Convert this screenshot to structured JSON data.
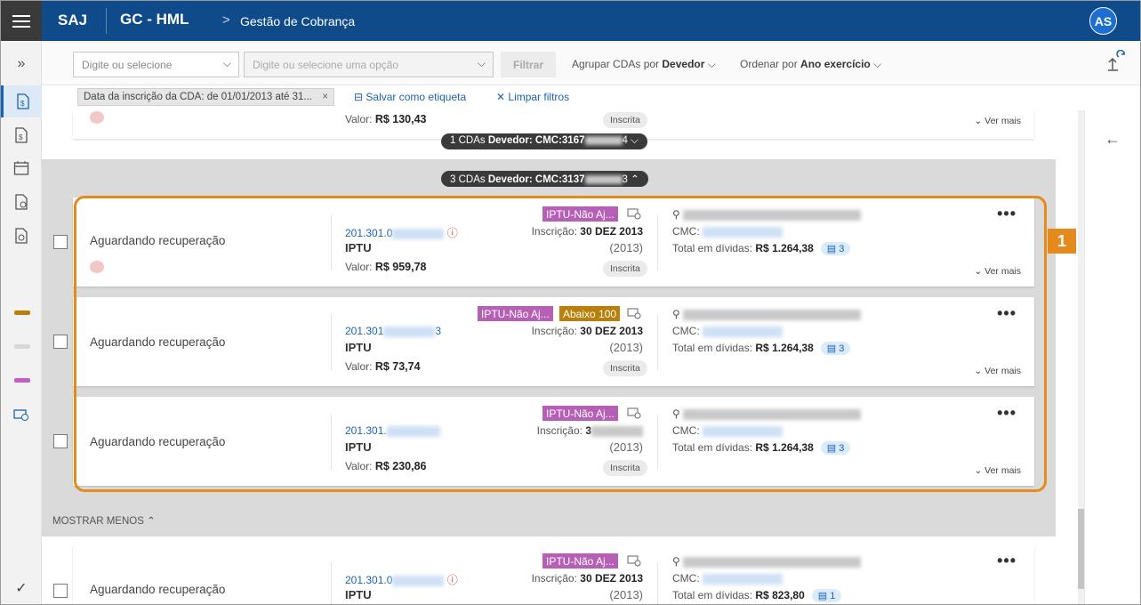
{
  "header": {
    "brand": "SAJ",
    "environment": "GC - HML",
    "breadcrumb_sep": ">",
    "breadcrumb": "Gestão de Cobrança",
    "avatar_initials": "AS"
  },
  "rail": {
    "expand_label": "»",
    "check_label": "✓",
    "bars": [
      "#b8800a",
      "#d8d8d8",
      "#c35fc3"
    ]
  },
  "toolbar": {
    "select1_placeholder": "Digite ou selecione",
    "select2_placeholder": "Digite ou selecione uma opção",
    "filter_button": "Filtrar",
    "group_prefix": "Agrupar CDAs por",
    "group_value": "Devedor",
    "order_prefix": "Ordenar por",
    "order_value": "Ano exercício"
  },
  "chips": {
    "date_chip": "Data da inscrição da CDA: de 01/01/2013 até 31...",
    "chip_close": "×",
    "save_tag": "Salvar como etiqueta",
    "clear_filters": "Limpar filtros"
  },
  "top_card": {
    "valor_label": "Valor:",
    "valor": "R$ 130,43",
    "status_pill": "Inscrita",
    "ver_mais": "Ver mais"
  },
  "groups": [
    {
      "count": "1",
      "label": "CDAs",
      "debtor": "Devedor: CMC:3167",
      "suffix": "4",
      "chevron": "down"
    },
    {
      "count": "3",
      "label": "CDAs",
      "debtor": "Devedor: CMC:3137",
      "suffix": "3",
      "chevron": "up"
    }
  ],
  "cards": [
    {
      "status": "Aguardando recuperação",
      "cda": "201.301.0",
      "tipo": "IPTU",
      "valor_label": "Valor:",
      "valor": "R$ 959,78",
      "tags": [
        "IPTU-Não Aj..."
      ],
      "inscricao_label": "Inscrição:",
      "inscricao": "30 DEZ 2013",
      "ano": "(2013)",
      "pill": "Inscrita",
      "cmc_label": "CMC:",
      "total_label": "Total em dívidas:",
      "total": "R$ 1.264,38",
      "docs": "3",
      "ver_mais": "Ver mais"
    },
    {
      "status": "Aguardando recuperação",
      "cda": "201.301",
      "cda_suffix": "3",
      "tipo": "IPTU",
      "valor_label": "Valor:",
      "valor": "R$ 73,74",
      "tags": [
        "IPTU-Não Aj...",
        "Abaixo 100"
      ],
      "inscricao_label": "Inscrição:",
      "inscricao": "30 DEZ 2013",
      "ano": "(2013)",
      "pill": "Inscrita",
      "cmc_label": "CMC:",
      "total_label": "Total em dívidas:",
      "total": "R$ 1.264,38",
      "docs": "3",
      "ver_mais": "Ver mais"
    },
    {
      "status": "Aguardando recuperação",
      "cda": "201.301.",
      "tipo": "IPTU",
      "valor_label": "Valor:",
      "valor": "R$ 230,86",
      "tags": [
        "IPTU-Não Aj..."
      ],
      "inscricao_label": "Inscrição:",
      "inscricao": "3",
      "ano": "(2013)",
      "pill": "Inscrita",
      "cmc_label": "CMC:",
      "total_label": "Total em dívidas:",
      "total": "R$ 1.264,38",
      "docs": "3",
      "ver_mais": "Ver mais"
    },
    {
      "status": "Aguardando recuperação",
      "cda": "201.301.0",
      "tipo": "IPTU",
      "tags": [
        "IPTU-Não Aj..."
      ],
      "inscricao_label": "Inscrição:",
      "inscricao": "30 DEZ 2013",
      "ano": "(2013)",
      "cmc_label": "CMC:",
      "total_label": "Total em dívidas:",
      "total": "R$ 823,80",
      "docs": "1"
    }
  ],
  "show_less": "MOSTRAR MENOS",
  "callout_number": "1",
  "colors": {
    "header": "#0f4a8a",
    "accent": "#1a63b7",
    "highlight": "#e58a1c",
    "tag_pink": "#b55fb5",
    "tag_gold": "#b8800a"
  }
}
